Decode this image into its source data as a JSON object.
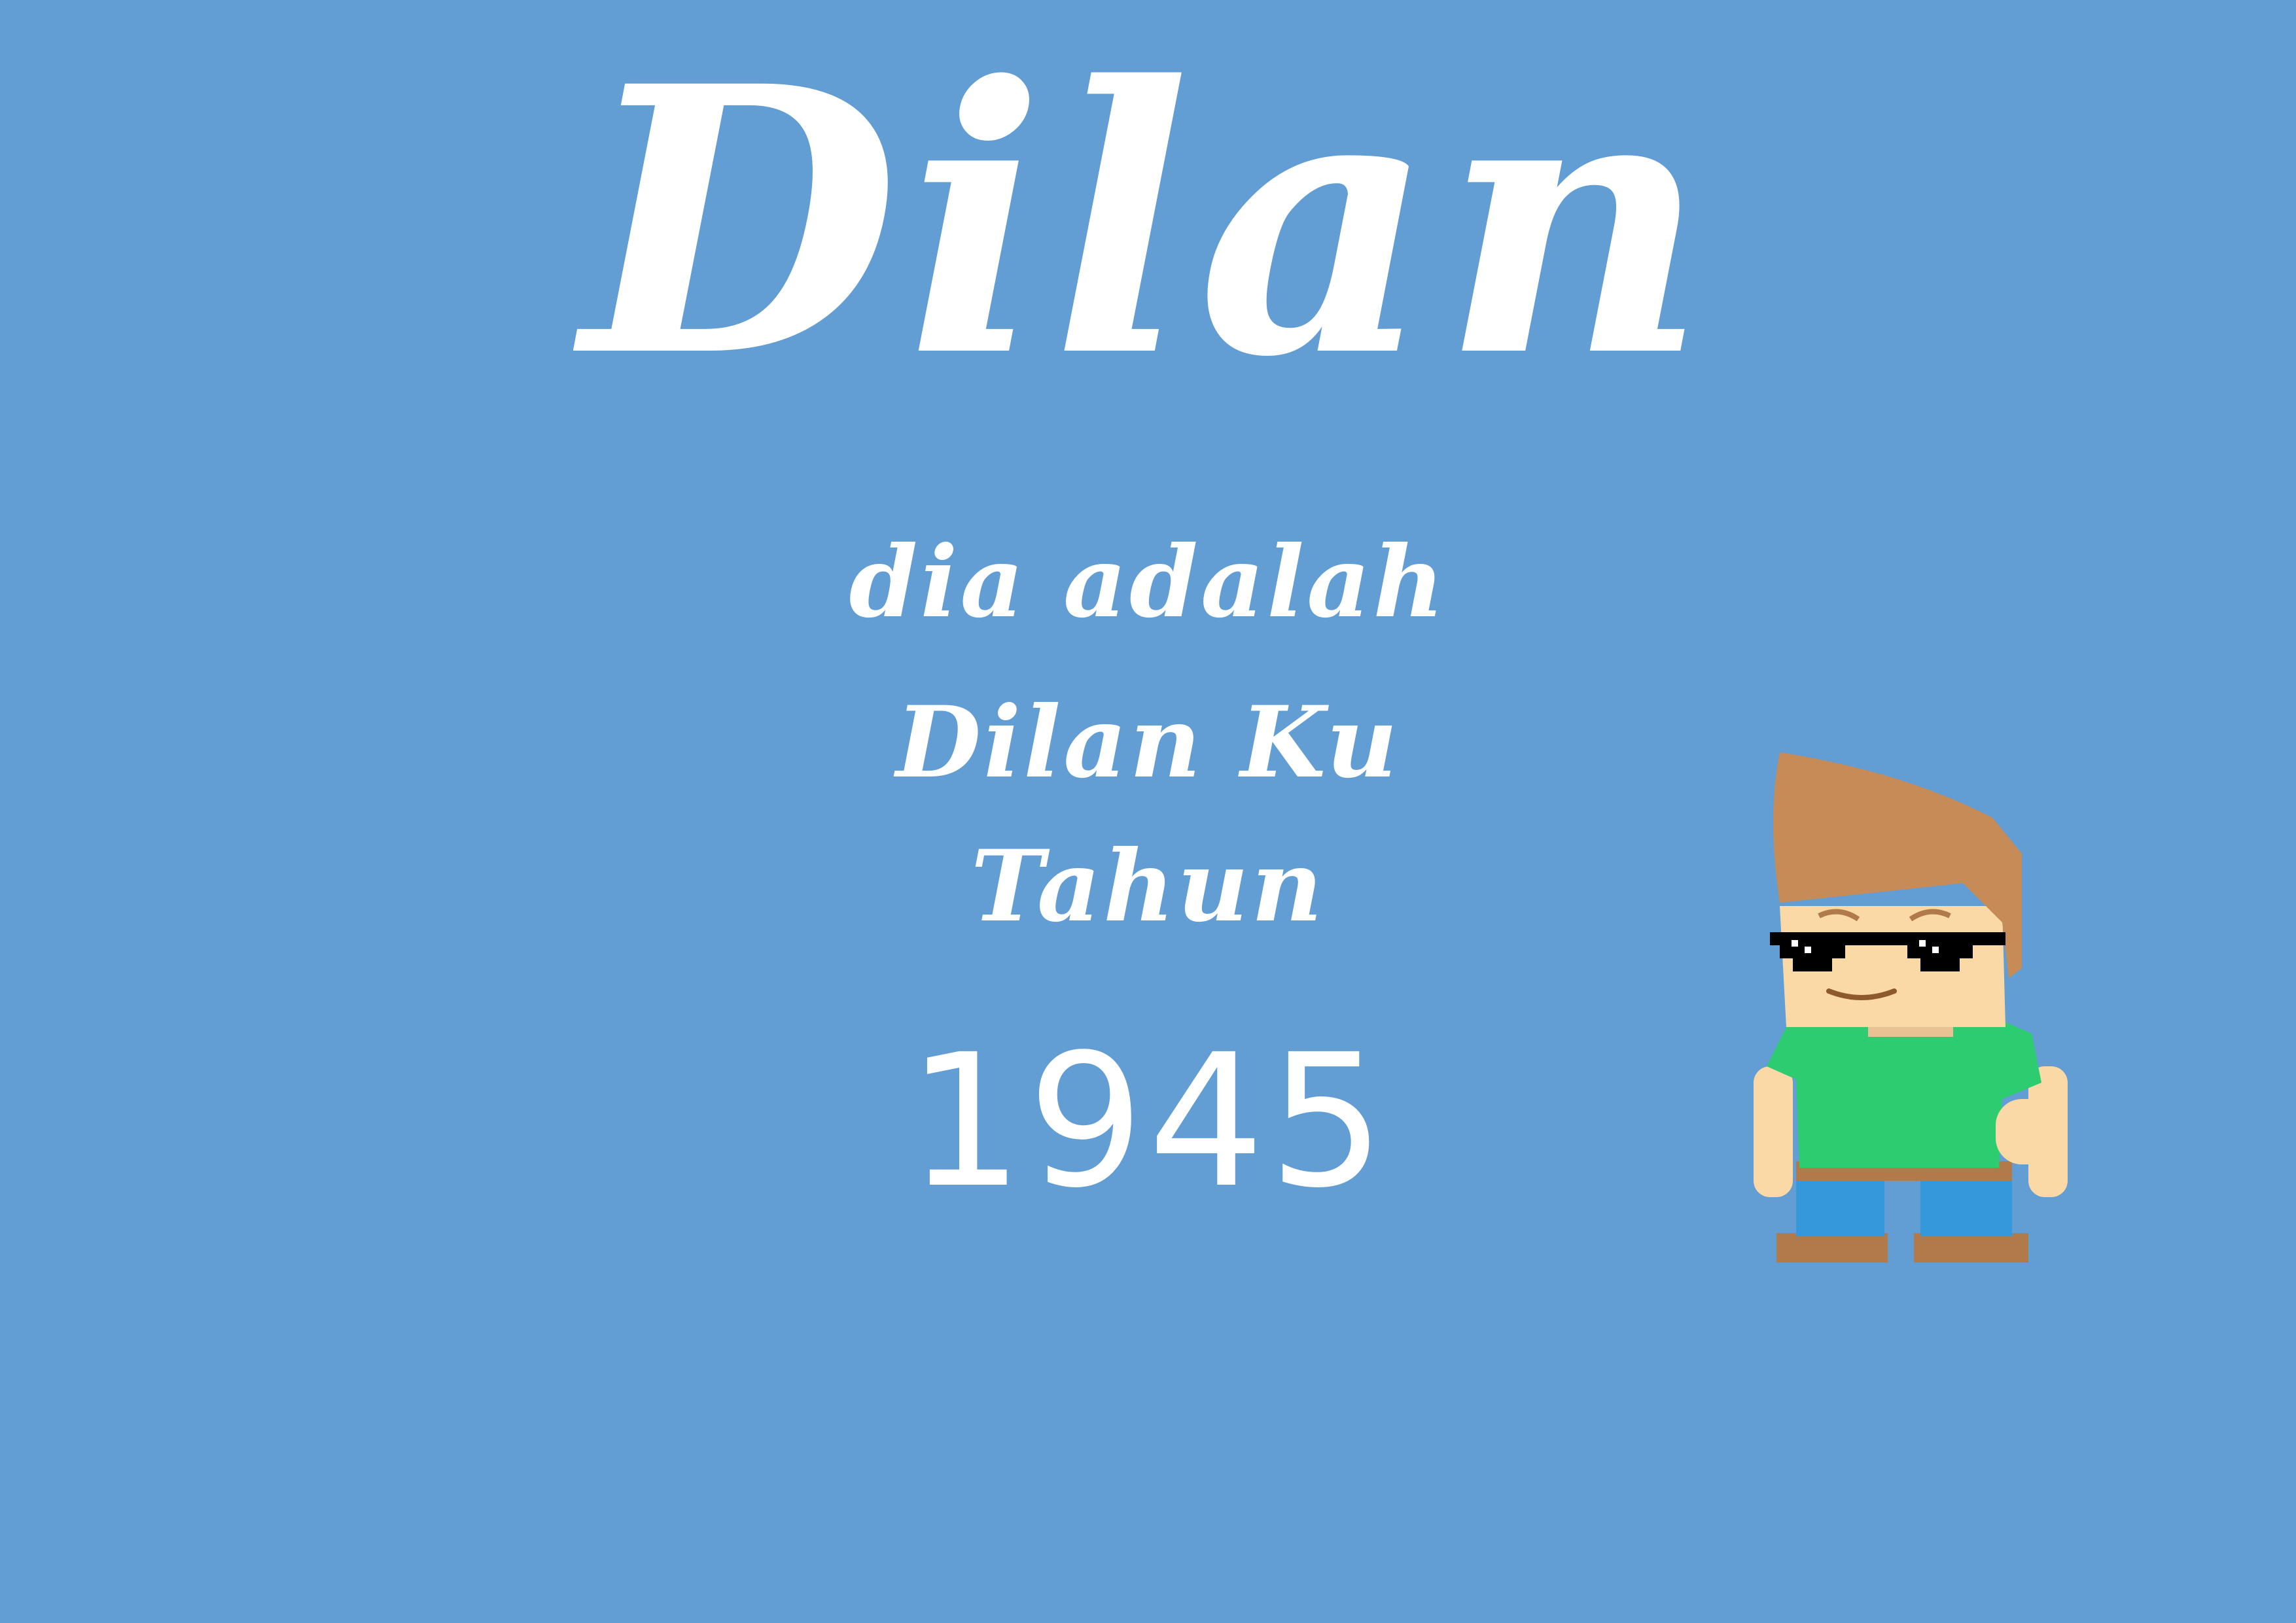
{
  "poster": {
    "title": "Dilan",
    "line1": "dia adalah",
    "line2": "Dilan Ku",
    "line3": "Tahun",
    "year": "1945"
  },
  "character": {
    "icon": "cartoon-boy-with-pixel-sunglasses",
    "colors": {
      "hair": "#c68b57",
      "skin": "#fbd9a6",
      "shirt": "#2ecc71",
      "pants": "#3498db",
      "belt": "#b07a4a",
      "shoes": "#b07a4a",
      "glasses": "#000000"
    }
  },
  "colors": {
    "background": "#629ed4",
    "text": "#ffffff"
  }
}
